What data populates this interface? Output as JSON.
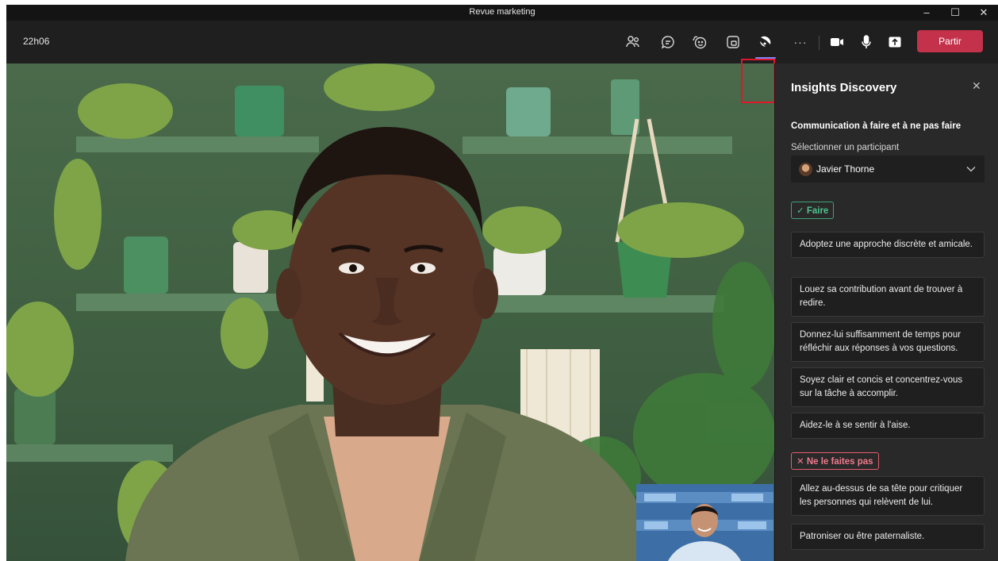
{
  "window": {
    "title": "Revue marketing",
    "controls": {
      "minimize": "–",
      "maximize": "☐",
      "close": "✕"
    }
  },
  "toolbar": {
    "clock": "22h06",
    "buttons": [
      "people-icon",
      "chat-icon",
      "reactions-icon",
      "view-icon",
      "apps-icon",
      "more-icon",
      "camera-icon",
      "mic-icon",
      "share-icon"
    ],
    "more_label": "···",
    "leave_label": "Partir",
    "leave_color": "#c4314b",
    "accent": "#7f85f5"
  },
  "panel": {
    "title": "Insights Discovery",
    "close": "✕",
    "section_title": "Communication à faire et à ne pas faire",
    "select_label": "Sélectionner un participant",
    "selected_participant": "Javier Thorne",
    "do_tag": "✓ Faire",
    "dont_tag": "✕ Ne le faites pas",
    "do_items": [
      "Adoptez une approche discrète et amicale.",
      "Louez sa contribution avant de trouver à redire.",
      "Donnez-lui suffisamment de temps pour réfléchir aux réponses à vos questions.",
      "Soyez clair et concis et concentrez-vous sur la tâche à accomplir.",
      "Aidez-le à se sentir à l'aise."
    ],
    "dont_items": [
      "Allez au-dessus de sa tête pour critiquer les personnes qui relèvent de lui.",
      "Patroniser ou être paternaliste."
    ]
  }
}
